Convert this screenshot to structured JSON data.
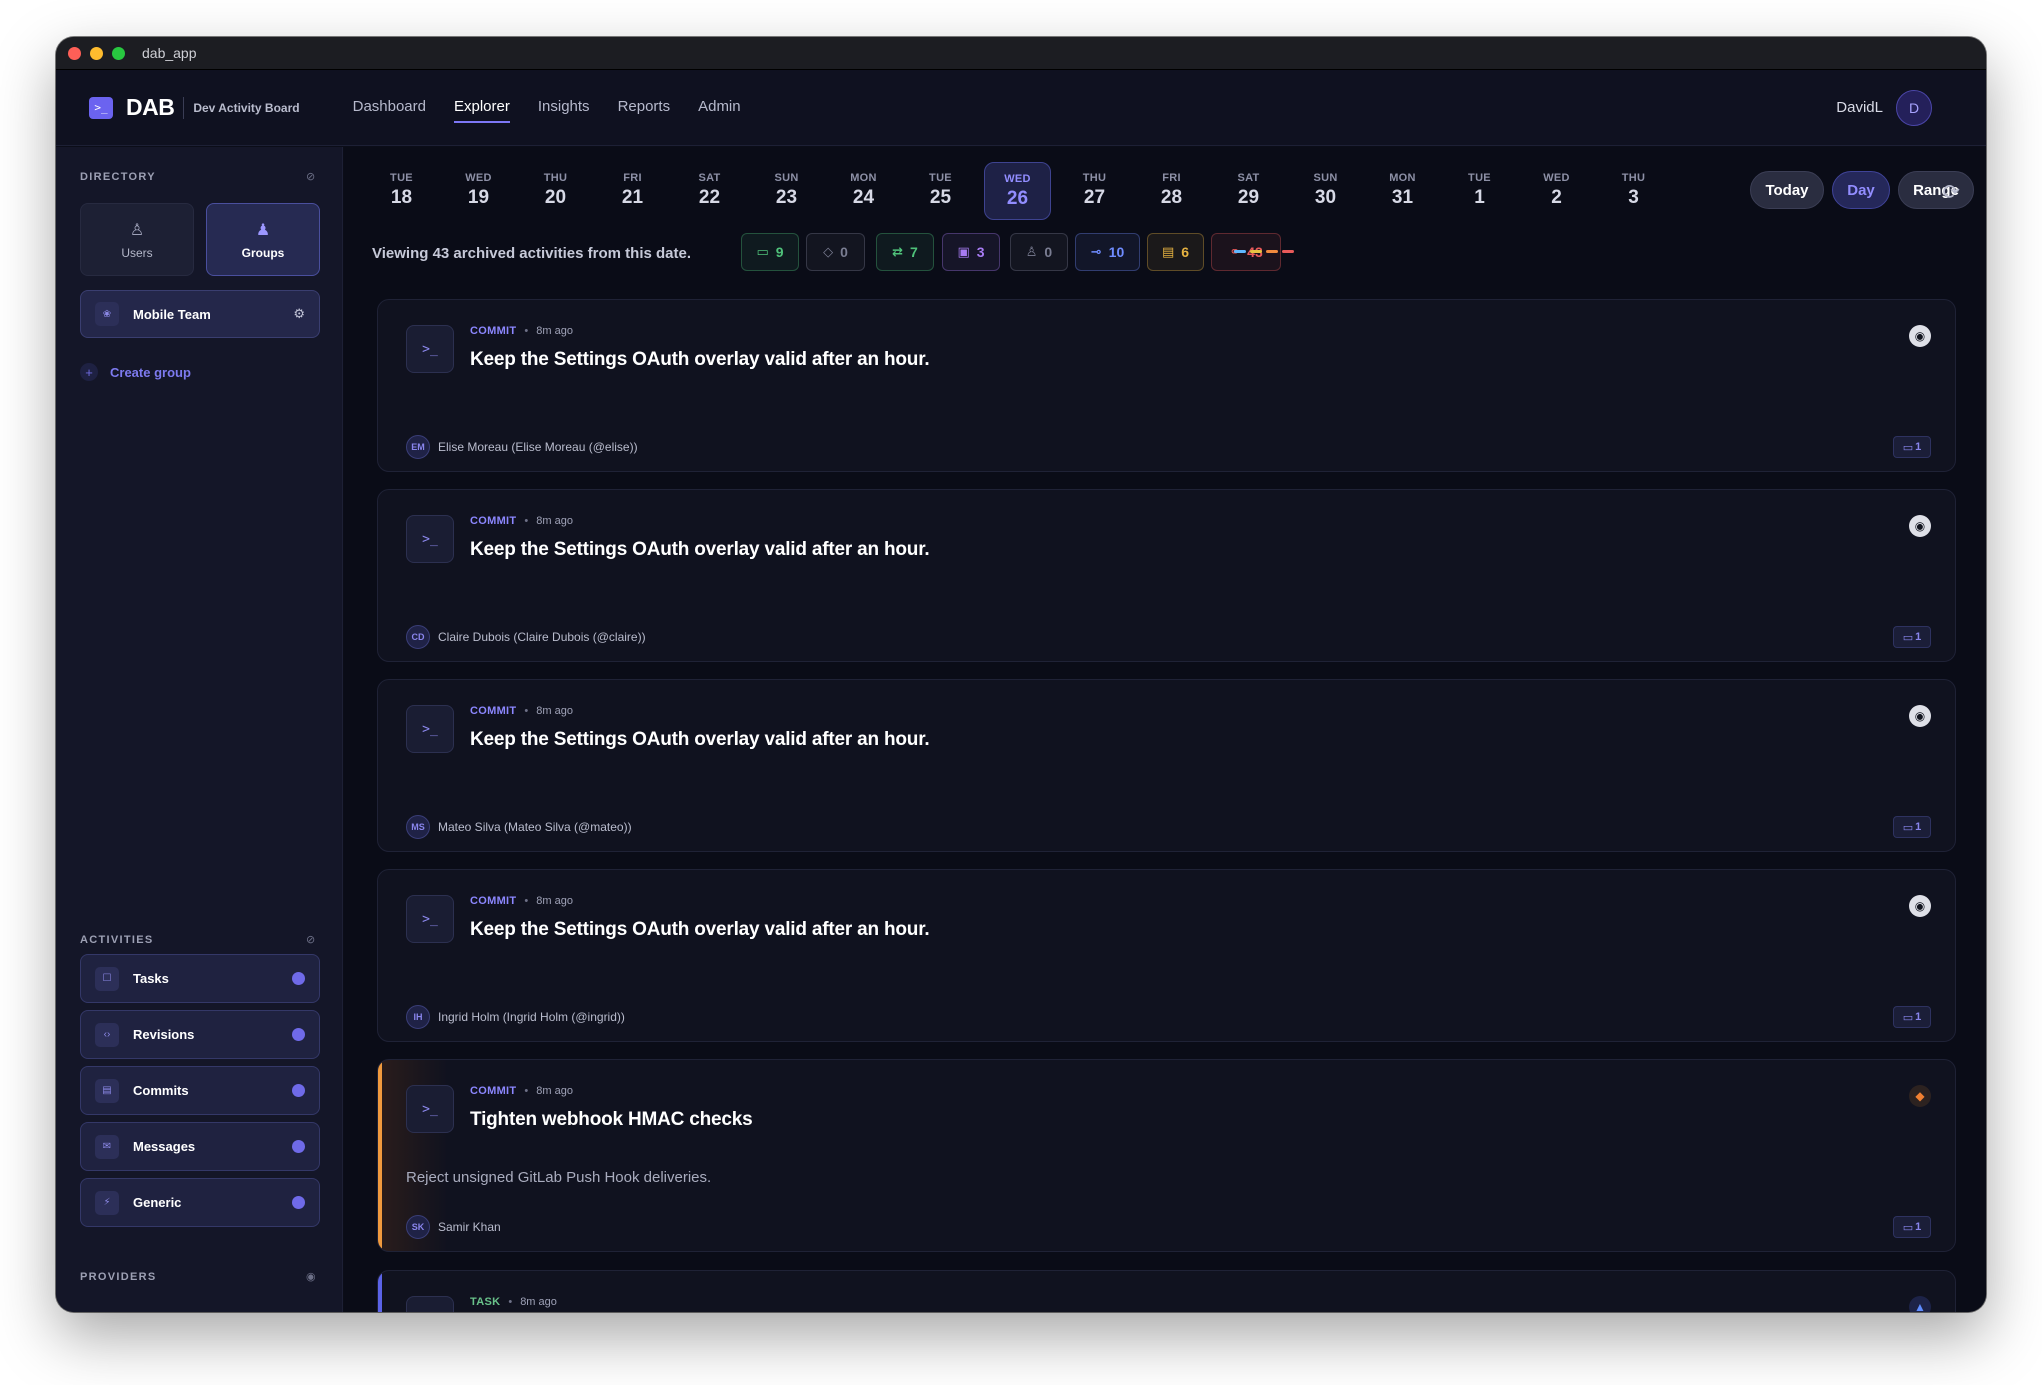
{
  "window": {
    "title": "dab_app"
  },
  "brand": {
    "logo_glyph": ">_",
    "name": "DAB",
    "subtitle": "Dev Activity Board"
  },
  "nav": [
    "Dashboard",
    "Explorer",
    "Insights",
    "Reports",
    "Admin"
  ],
  "active_nav": "Explorer",
  "user": {
    "name": "DavidL",
    "initial": "D"
  },
  "sidebar": {
    "directory_title": "DIRECTORY",
    "users_label": "Users",
    "groups_label": "Groups",
    "group_item": "Mobile Team",
    "create_group": "Create group",
    "activities_title": "ACTIVITIES",
    "activities": [
      "Tasks",
      "Revisions",
      "Commits",
      "Messages",
      "Generic"
    ],
    "providers_title": "PROVIDERS"
  },
  "dates": [
    {
      "dow": "TUE",
      "day": "18"
    },
    {
      "dow": "WED",
      "day": "19"
    },
    {
      "dow": "THU",
      "day": "20"
    },
    {
      "dow": "FRI",
      "day": "21"
    },
    {
      "dow": "SAT",
      "day": "22"
    },
    {
      "dow": "SUN",
      "day": "23"
    },
    {
      "dow": "MON",
      "day": "24"
    },
    {
      "dow": "TUE",
      "day": "25"
    },
    {
      "dow": "WED",
      "day": "26"
    },
    {
      "dow": "THU",
      "day": "27"
    },
    {
      "dow": "FRI",
      "day": "28"
    },
    {
      "dow": "SAT",
      "day": "29"
    },
    {
      "dow": "SUN",
      "day": "30"
    },
    {
      "dow": "MON",
      "day": "31"
    },
    {
      "dow": "TUE",
      "day": "1"
    },
    {
      "dow": "WED",
      "day": "2"
    },
    {
      "dow": "THU",
      "day": "3"
    }
  ],
  "selected_date_index": 8,
  "controls": {
    "today": "Today",
    "day": "Day",
    "range": "Range"
  },
  "viewing_text": "Viewing 43 archived activities from this date.",
  "filters": [
    {
      "icon": "message-icon",
      "count": "9",
      "color": "#4fc27a"
    },
    {
      "icon": "tag-icon",
      "count": "0",
      "color": "#7a7d92"
    },
    {
      "icon": "pull-request-icon",
      "count": "7",
      "color": "#4fc27a"
    },
    {
      "icon": "card-icon",
      "count": "3",
      "color": "#a77bf2"
    },
    {
      "icon": "user-add-icon",
      "count": "0",
      "color": "#7a7d92"
    },
    {
      "icon": "commit-icon",
      "count": "10",
      "color": "#6f8cff"
    },
    {
      "icon": "comment-icon",
      "count": "6",
      "color": "#e7b341"
    },
    {
      "icon": "link-icon",
      "count": "43",
      "color": "#e85a5a"
    }
  ],
  "activities": [
    {
      "type": "COMMIT",
      "ago": "8m ago",
      "title": "Keep the Settings OAuth overlay valid after an hour.",
      "desc": "",
      "initials": "EM",
      "author": "Elise Moreau (Elise Moreau (@elise))",
      "count": "1",
      "provider": "github"
    },
    {
      "type": "COMMIT",
      "ago": "8m ago",
      "title": "Keep the Settings OAuth overlay valid after an hour.",
      "desc": "",
      "initials": "CD",
      "author": "Claire Dubois (Claire Dubois (@claire))",
      "count": "1",
      "provider": "github"
    },
    {
      "type": "COMMIT",
      "ago": "8m ago",
      "title": "Keep the Settings OAuth overlay valid after an hour.",
      "desc": "",
      "initials": "MS",
      "author": "Mateo Silva (Mateo Silva (@mateo))",
      "count": "1",
      "provider": "github"
    },
    {
      "type": "COMMIT",
      "ago": "8m ago",
      "title": "Keep the Settings OAuth overlay valid after an hour.",
      "desc": "",
      "initials": "IH",
      "author": "Ingrid Holm (Ingrid Holm (@ingrid))",
      "count": "1",
      "provider": "github"
    },
    {
      "type": "COMMIT",
      "ago": "8m ago",
      "title": "Tighten webhook HMAC checks",
      "desc": "Reject unsigned GitLab Push Hook deliveries.",
      "initials": "SK",
      "author": "Samir Khan",
      "count": "1",
      "provider": "gitlab"
    },
    {
      "type": "TASK",
      "ago": "8m ago",
      "title": "",
      "desc": "",
      "initials": "",
      "author": "",
      "count": "",
      "provider": "jira"
    }
  ]
}
